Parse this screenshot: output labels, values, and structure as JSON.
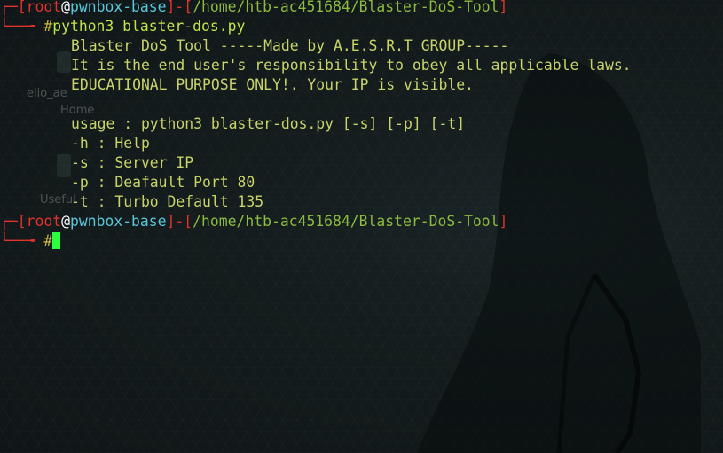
{
  "prompt1": {
    "user": "root",
    "at": "@",
    "host": "pwnbox-base",
    "sep": "]-[",
    "path": "/home/htb-ac451684/Blaster-DoS-Tool",
    "close": "]",
    "open": "[",
    "hash": "#",
    "command": "python3 blaster-dos.py"
  },
  "output": [
    "Blaster DoS Tool -----Made by A.E.S.R.T GROUP-----",
    "It is the end user's responsibility to obey all applicable laws.",
    "EDUCATIONAL PURPOSE ONLY!. Your IP is visible.",
    "usage : python3 blaster-dos.py [-s] [-p] [-t]",
    "-h : Help",
    "-s : Server IP",
    "-p : Deafault Port 80",
    "-t : Turbo Default 135"
  ],
  "prompt2": {
    "user": "root",
    "at": "@",
    "host": "pwnbox-base",
    "sep": "]-[",
    "path": "/home/htb-ac451684/Blaster-DoS-Tool",
    "close": "]",
    "open": "[",
    "hash": "#"
  },
  "background": {
    "ghost_text_1": "elio_ae",
    "ghost_text_2": "Home",
    "ghost_text_3": "Useful"
  }
}
